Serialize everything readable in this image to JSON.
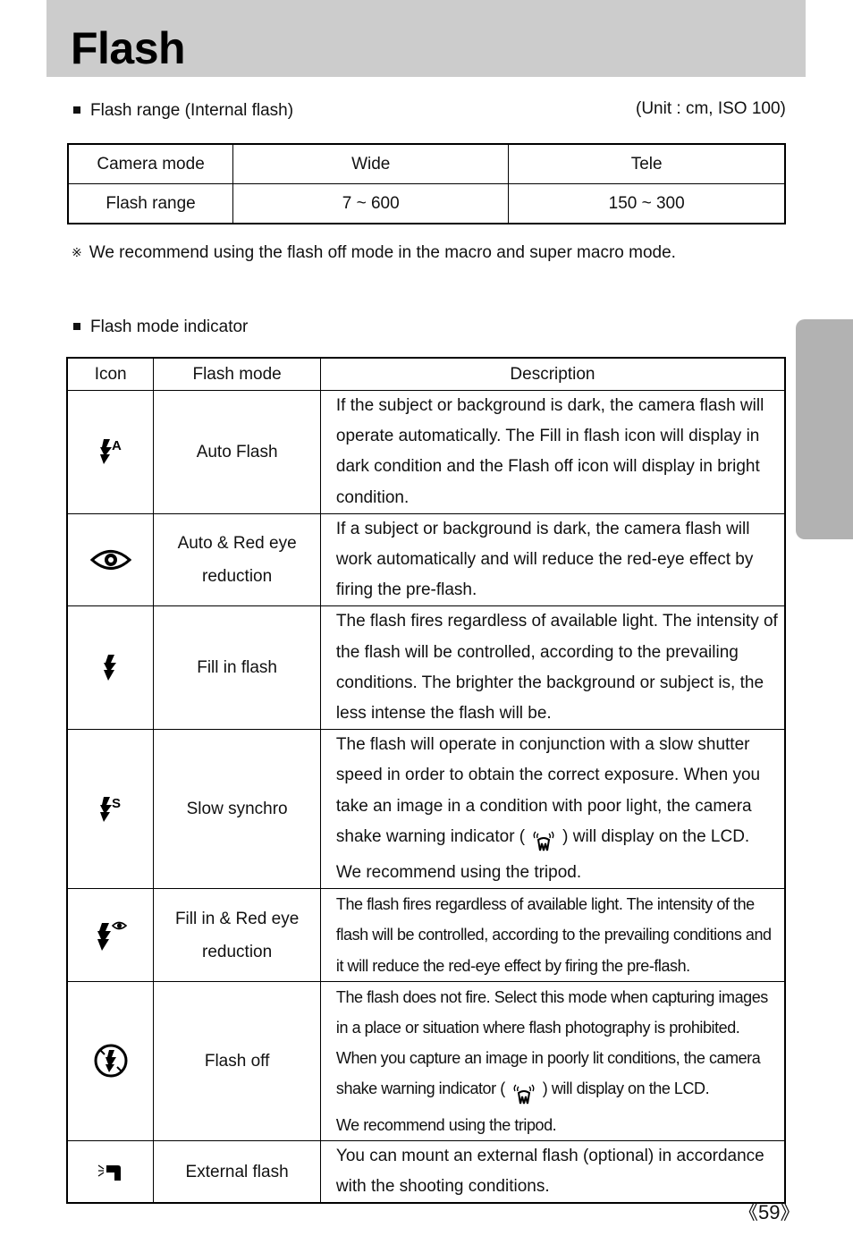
{
  "page": {
    "title": "Flash",
    "page_number": "《59》"
  },
  "range_section": {
    "heading": "Flash range (Internal flash)",
    "unit_note": "(Unit : cm, ISO 100)",
    "table": {
      "headers": [
        "Camera mode",
        "Wide",
        "Tele"
      ],
      "rows": [
        [
          "Flash range",
          "7 ~ 600",
          "150 ~ 300"
        ]
      ]
    },
    "note_mark": "※",
    "note": "We recommend using the flash off mode in the macro and super macro mode."
  },
  "indicator_section": {
    "heading": "Flash mode indicator",
    "headers": {
      "icon": "Icon",
      "mode": "Flash mode",
      "description": "Description"
    },
    "rows": [
      {
        "icon": "auto-flash-icon",
        "icon_label": "A",
        "mode_lines": [
          "Auto Flash"
        ],
        "description": "If the subject or background is dark, the camera flash will operate automatically. The Fill in flash icon will display in dark condition and the Flash off icon will display in bright condition."
      },
      {
        "icon": "red-eye-icon",
        "mode_lines": [
          "Auto & Red eye",
          "reduction"
        ],
        "description": "If a subject or background is dark, the camera flash will work automatically and will reduce the red-eye effect by firing the pre-flash."
      },
      {
        "icon": "fill-flash-icon",
        "mode_lines": [
          "Fill in flash"
        ],
        "description": "The flash fires regardless of available light. The intensity of the flash will be controlled, according to the prevailing conditions. The brighter the background or subject is, the less intense the flash will be."
      },
      {
        "icon": "slow-synchro-icon",
        "icon_label": "S",
        "mode_lines": [
          "Slow synchro"
        ],
        "description_before": "The flash will operate in conjunction with a slow shutter speed in order to obtain the correct exposure. When you take an image in a condition with poor light, the camera shake warning indicator (",
        "description_after": ") will display on the LCD.",
        "description_last": "We recommend using the tripod."
      },
      {
        "icon": "fill-red-eye-icon",
        "mode_lines": [
          "Fill in & Red eye",
          "reduction"
        ],
        "description": "The flash fires regardless of available light. The intensity of the flash will be controlled, according to the prevailing conditions and it will reduce the red-eye effect by firing the pre-flash."
      },
      {
        "icon": "flash-off-icon",
        "mode_lines": [
          "Flash off"
        ],
        "description_before": "The flash does not fire. Select this mode when capturing images in a place or situation where flash photography is prohibited. When you capture an image in poorly lit conditions, the camera shake warning indicator (",
        "description_after": ") will display on the LCD.",
        "description_last": "We recommend using the tripod."
      },
      {
        "icon": "external-flash-icon",
        "mode_lines": [
          "External flash"
        ],
        "description": "You can mount an external flash (optional) in accordance with the shooting conditions."
      }
    ]
  }
}
